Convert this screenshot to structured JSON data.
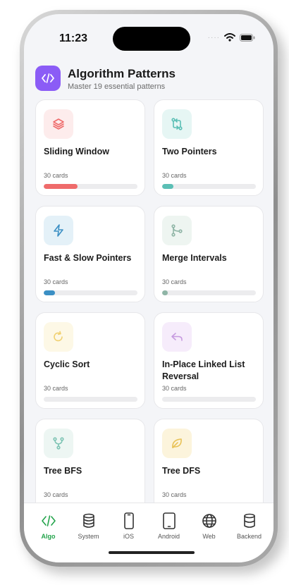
{
  "status": {
    "time": "11:23"
  },
  "header": {
    "title": "Algorithm Patterns",
    "subtitle": "Master 19 essential patterns"
  },
  "colors": {
    "accent_purple": "#8b5cf6",
    "active_tab": "#22a34a"
  },
  "cards": [
    {
      "title": "Sliding Window",
      "count": "30 cards",
      "icon": "layers-icon",
      "color": "#ef6b6b",
      "bg": "#fdecec",
      "progress": 0.36
    },
    {
      "title": "Two Pointers",
      "count": "30 cards",
      "icon": "swap-arrows-icon",
      "color": "#5bbfb5",
      "bg": "#e6f6f4",
      "progress": 0.12
    },
    {
      "title": "Fast & Slow Pointers",
      "count": "30 cards",
      "icon": "lightning-icon",
      "color": "#3b8fc4",
      "bg": "#e4f1f8",
      "progress": 0.12
    },
    {
      "title": "Merge Intervals",
      "count": "30 cards",
      "icon": "git-merge-icon",
      "color": "#8fb5a6",
      "bg": "#eef5f1",
      "progress": 0.06
    },
    {
      "title": "Cyclic Sort",
      "count": "30 cards",
      "icon": "refresh-icon",
      "color": "#f0d070",
      "bg": "#fdf8e6",
      "progress": 0
    },
    {
      "title": "In-Place Linked List Reversal",
      "count": "30 cards",
      "icon": "undo-icon",
      "color": "#c79be0",
      "bg": "#f6ecfb",
      "progress": 0
    },
    {
      "title": "Tree BFS",
      "count": "30 cards",
      "icon": "git-branch-icon",
      "color": "#7ec4b4",
      "bg": "#edf6f3",
      "progress": 0
    },
    {
      "title": "Tree DFS",
      "count": "30 cards",
      "icon": "leaf-icon",
      "color": "#e8c257",
      "bg": "#fcf4dc",
      "progress": 0
    }
  ],
  "tabs": [
    {
      "label": "Algo",
      "icon": "code-icon",
      "active": true
    },
    {
      "label": "System",
      "icon": "database-icon",
      "active": false
    },
    {
      "label": "iOS",
      "icon": "phone-icon",
      "active": false
    },
    {
      "label": "Android",
      "icon": "tablet-icon",
      "active": false
    },
    {
      "label": "Web",
      "icon": "globe-icon",
      "active": false
    },
    {
      "label": "Backend",
      "icon": "server-icon",
      "active": false
    }
  ]
}
